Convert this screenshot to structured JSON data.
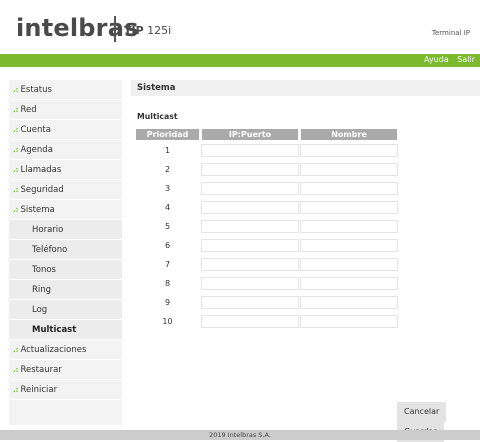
{
  "header": {
    "logo": "intelbras",
    "model_prefix": "TIP",
    "model_suffix": "125i",
    "terminal_label": "Terminal IP"
  },
  "topnav": {
    "help": "Ayuda",
    "logout": "Salir"
  },
  "sidebar": {
    "items": [
      {
        "label": "Estatus"
      },
      {
        "label": "Red"
      },
      {
        "label": "Cuenta"
      },
      {
        "label": "Agenda"
      },
      {
        "label": "Llamadas"
      },
      {
        "label": "Seguridad"
      },
      {
        "label": "Sistema"
      }
    ],
    "subitems": [
      {
        "label": "Horario"
      },
      {
        "label": "Teléfono"
      },
      {
        "label": "Tonos"
      },
      {
        "label": "Ring"
      },
      {
        "label": "Log"
      },
      {
        "label": "Multicast"
      }
    ],
    "items_after": [
      {
        "label": "Actualizaciones"
      },
      {
        "label": "Restaurar"
      },
      {
        "label": "Reiniciar"
      }
    ],
    "bullet": ".:"
  },
  "main": {
    "page_title": "Sistema",
    "section_title": "Multicast",
    "table": {
      "headers": [
        "Prioridad",
        "IP:Puerto",
        "Nombre"
      ],
      "rows": [
        {
          "priority": "1",
          "ip_port": "",
          "name": ""
        },
        {
          "priority": "2",
          "ip_port": "",
          "name": ""
        },
        {
          "priority": "3",
          "ip_port": "",
          "name": ""
        },
        {
          "priority": "4",
          "ip_port": "",
          "name": ""
        },
        {
          "priority": "5",
          "ip_port": "",
          "name": ""
        },
        {
          "priority": "6",
          "ip_port": "",
          "name": ""
        },
        {
          "priority": "7",
          "ip_port": "",
          "name": ""
        },
        {
          "priority": "8",
          "ip_port": "",
          "name": ""
        },
        {
          "priority": "9",
          "ip_port": "",
          "name": ""
        },
        {
          "priority": "10",
          "ip_port": "",
          "name": ""
        }
      ]
    },
    "buttons": {
      "cancel": "Cancelar",
      "save": "Guardar"
    }
  },
  "footer": {
    "text": "2019 Intelbras S.A."
  },
  "colors": {
    "brand_green": "#7bba2c",
    "table_header": "#aaaaaa",
    "sidebar_bg": "#f3f3f3",
    "footer_bg": "#cccccc"
  }
}
